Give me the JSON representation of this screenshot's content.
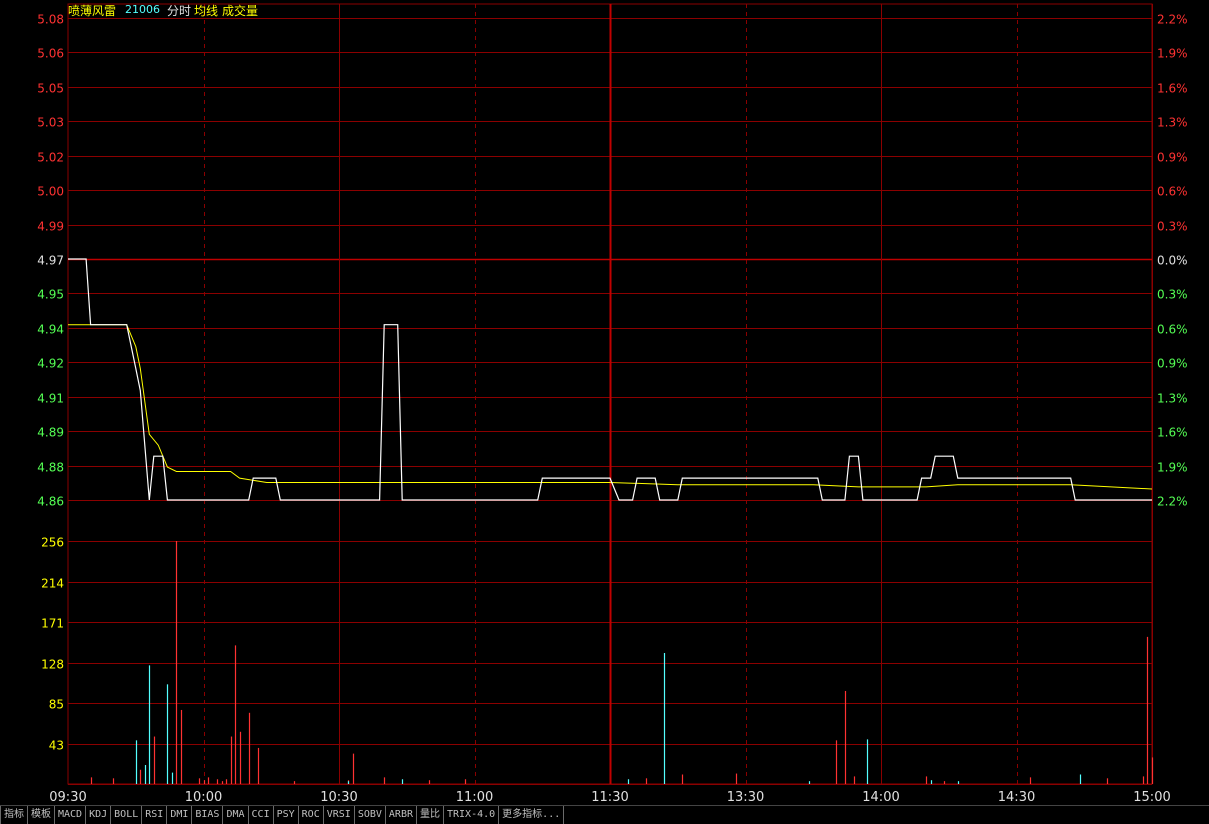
{
  "header": {
    "stock_name": "喷薄风雷",
    "stock_code": "21006",
    "mode_label": "分时",
    "avg_label": "均线",
    "vol_label": "成交量"
  },
  "colors": {
    "grid": "#8b0000",
    "up": "#ff3232",
    "down": "#54ff54",
    "neutral": "#e0e0e0",
    "price_line": "#ffffff",
    "avg_line": "#ffff00",
    "vol_up": "#ff3232",
    "vol_down": "#54ffff",
    "volume_axis": "#ffff00",
    "time_axis": "#e0e0e0"
  },
  "price_axis": {
    "left_labels": [
      "5.08",
      "5.06",
      "5.05",
      "5.03",
      "5.02",
      "5.00",
      "4.99",
      "4.97",
      "4.95",
      "4.94",
      "4.92",
      "4.91",
      "4.89",
      "4.88",
      "4.86"
    ],
    "right_labels": [
      "2.2%",
      "1.9%",
      "1.6%",
      "1.3%",
      "0.9%",
      "0.6%",
      "0.3%",
      "0.0%",
      "0.3%",
      "0.6%",
      "0.9%",
      "1.3%",
      "1.6%",
      "1.9%",
      "2.2%"
    ],
    "prev_close_index": 7
  },
  "volume_axis": {
    "labels": [
      "256",
      "214",
      "171",
      "128",
      "85",
      "43"
    ]
  },
  "time_axis": {
    "labels": [
      "09:30",
      "10:00",
      "10:30",
      "11:00",
      "11:30",
      "13:30",
      "14:00",
      "14:30",
      "15:00"
    ]
  },
  "chart_data": {
    "type": "line",
    "title": "",
    "prev_close": 4.97,
    "price_range": [
      4.86,
      5.08
    ],
    "volume_range": [
      0,
      256
    ],
    "minutes_per_session": 240,
    "price": [
      [
        0,
        4.97
      ],
      [
        4,
        4.97
      ],
      [
        5,
        4.94
      ],
      [
        13,
        4.94
      ],
      [
        15,
        4.92
      ],
      [
        16,
        4.91
      ],
      [
        18,
        4.86
      ],
      [
        19,
        4.88
      ],
      [
        21,
        4.88
      ],
      [
        22,
        4.86
      ],
      [
        40,
        4.86
      ],
      [
        41,
        4.87
      ],
      [
        46,
        4.87
      ],
      [
        47,
        4.86
      ],
      [
        69,
        4.86
      ],
      [
        70,
        4.94
      ],
      [
        73,
        4.94
      ],
      [
        74,
        4.86
      ],
      [
        104,
        4.86
      ],
      [
        105,
        4.87
      ],
      [
        120,
        4.87
      ],
      [
        122,
        4.86
      ],
      [
        125,
        4.86
      ],
      [
        126,
        4.87
      ],
      [
        130,
        4.87
      ],
      [
        131,
        4.86
      ],
      [
        135,
        4.86
      ],
      [
        136,
        4.87
      ],
      [
        166,
        4.87
      ],
      [
        167,
        4.86
      ],
      [
        172,
        4.86
      ],
      [
        173,
        4.88
      ],
      [
        175,
        4.88
      ],
      [
        176,
        4.86
      ],
      [
        188,
        4.86
      ],
      [
        189,
        4.87
      ],
      [
        191,
        4.87
      ],
      [
        192,
        4.88
      ],
      [
        196,
        4.88
      ],
      [
        197,
        4.87
      ],
      [
        222,
        4.87
      ],
      [
        223,
        4.86
      ],
      [
        240,
        4.86
      ]
    ],
    "average": [
      [
        0,
        4.94
      ],
      [
        13,
        4.94
      ],
      [
        15,
        4.93
      ],
      [
        16,
        4.92
      ],
      [
        18,
        4.89
      ],
      [
        20,
        4.885
      ],
      [
        22,
        4.875
      ],
      [
        24,
        4.873
      ],
      [
        36,
        4.873
      ],
      [
        38,
        4.87
      ],
      [
        44,
        4.868
      ],
      [
        80,
        4.868
      ],
      [
        100,
        4.868
      ],
      [
        120,
        4.868
      ],
      [
        135,
        4.867
      ],
      [
        165,
        4.867
      ],
      [
        175,
        4.866
      ],
      [
        190,
        4.866
      ],
      [
        197,
        4.867
      ],
      [
        222,
        4.867
      ],
      [
        240,
        4.865
      ]
    ],
    "volume": [
      [
        5,
        7,
        "up"
      ],
      [
        10,
        6,
        "up"
      ],
      [
        15,
        46,
        "down"
      ],
      [
        16,
        15,
        "up"
      ],
      [
        17,
        20,
        "down"
      ],
      [
        18,
        125,
        "down"
      ],
      [
        19,
        50,
        "up"
      ],
      [
        22,
        105,
        "down"
      ],
      [
        23,
        12,
        "down"
      ],
      [
        24,
        256,
        "up"
      ],
      [
        25,
        78,
        "up"
      ],
      [
        29,
        6,
        "up"
      ],
      [
        30,
        4,
        "up"
      ],
      [
        31,
        7,
        "up"
      ],
      [
        33,
        5,
        "up"
      ],
      [
        34,
        3,
        "up"
      ],
      [
        35,
        5,
        "up"
      ],
      [
        36,
        50,
        "up"
      ],
      [
        37,
        146,
        "up"
      ],
      [
        38,
        55,
        "up"
      ],
      [
        40,
        75,
        "up"
      ],
      [
        42,
        38,
        "up"
      ],
      [
        50,
        3,
        "up"
      ],
      [
        62,
        4,
        "up"
      ],
      [
        62,
        3,
        "down"
      ],
      [
        63,
        32,
        "up"
      ],
      [
        70,
        7,
        "up"
      ],
      [
        74,
        5,
        "down"
      ],
      [
        80,
        4,
        "up"
      ],
      [
        88,
        5,
        "up"
      ],
      [
        124,
        5,
        "down"
      ],
      [
        128,
        6,
        "up"
      ],
      [
        132,
        138,
        "down"
      ],
      [
        136,
        10,
        "up"
      ],
      [
        148,
        11,
        "up"
      ],
      [
        164,
        3,
        "down"
      ],
      [
        170,
        46,
        "up"
      ],
      [
        172,
        98,
        "up"
      ],
      [
        174,
        8,
        "up"
      ],
      [
        177,
        47,
        "down"
      ],
      [
        190,
        8,
        "up"
      ],
      [
        191,
        4,
        "down"
      ],
      [
        194,
        3,
        "up"
      ],
      [
        197,
        3,
        "down"
      ],
      [
        213,
        7,
        "up"
      ],
      [
        224,
        10,
        "down"
      ],
      [
        230,
        6,
        "up"
      ],
      [
        238,
        8,
        "up"
      ],
      [
        239,
        155,
        "up"
      ],
      [
        240,
        28,
        "up"
      ]
    ]
  },
  "tabs": [
    "指标",
    "模板",
    "MACD",
    "KDJ",
    "BOLL",
    "RSI",
    "DMI",
    "BIAS",
    "DMA",
    "CCI",
    "PSY",
    "ROC",
    "VRSI",
    "SOBV",
    "ARBR",
    "量比",
    "TRIX-4.0",
    "更多指标..."
  ]
}
